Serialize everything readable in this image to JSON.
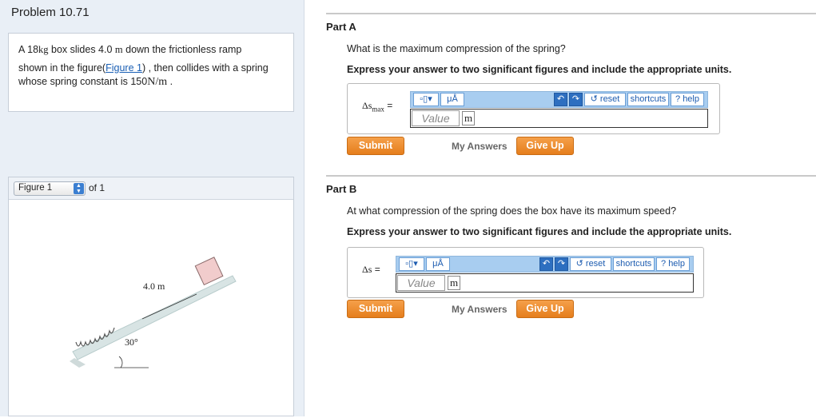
{
  "problem": {
    "title": "Problem 10.71",
    "text_pre_mass": "A 18",
    "mass_unit": "kg",
    "text_after_mass": " box slides 4.0 ",
    "length_unit": "m",
    "text_after_length": " down the frictionless ramp",
    "line2_pre_link": "shown in the figure(",
    "figure_link": "Figure 1",
    "line2_post_link": ") , then collides with a spring",
    "line3_pre": "whose spring constant is 150",
    "spring_unit": "N/m",
    "line3_post": " ."
  },
  "figure": {
    "select_value": "Figure 1",
    "of_label": "of 1",
    "distance_label": "4.0 m",
    "angle_label": "30°"
  },
  "partA": {
    "title": "Part A",
    "question": "What is the maximum compression of the spring?",
    "instruction": "Express your answer to two significant figures and include the appropriate units.",
    "label_symbol": "Δs",
    "label_sub": "max",
    "label_eq": " =",
    "units_btn": "μÅ",
    "reset": "reset",
    "shortcuts": "shortcuts",
    "help": "help",
    "value_placeholder": "Value",
    "unit": "m",
    "submit": "Submit",
    "my_answers": "My Answers",
    "give_up": "Give Up"
  },
  "partB": {
    "title": "Part B",
    "question": "At what compression of the spring does the box have its maximum speed?",
    "instruction": "Express your answer to two significant figures and include the appropriate units.",
    "label_symbol": "Δs",
    "label_eq": " =",
    "units_btn": "μÅ",
    "reset": "reset",
    "shortcuts": "shortcuts",
    "help": "help",
    "value_placeholder": "Value",
    "unit": "m",
    "submit": "Submit",
    "my_answers": "My Answers",
    "give_up": "Give Up"
  },
  "icons": {
    "templates": "templates-icon",
    "units": "units-icon",
    "undo": "undo-icon",
    "redo": "redo-icon",
    "reset": "reset-icon",
    "help": "help-icon"
  },
  "colors": {
    "accent_orange": "#e8841f",
    "toolbar_blue": "#a8cdf0",
    "link_blue": "#1a5fb4",
    "panel_bg": "#e9eff6"
  }
}
